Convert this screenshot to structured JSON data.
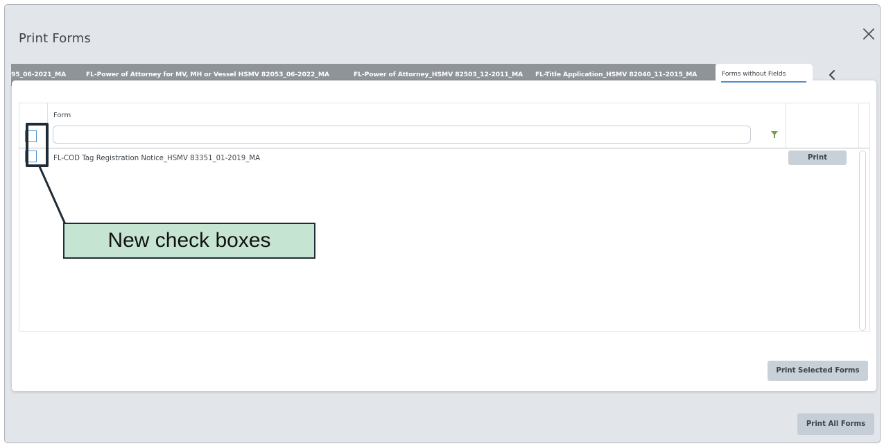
{
  "dialog": {
    "title": "Print Forms",
    "close_icon": "close-icon"
  },
  "tabs": [
    {
      "label": "95_06-2021_MA"
    },
    {
      "label": "FL-Power of Attorney for MV, MH or Vessel HSMV 82053_06-2022_MA"
    },
    {
      "label": "FL-Power of Attorney_HSMV 82503_12-2011_MA"
    },
    {
      "label": "FL-Title Application_HSMV 82040_11-2015_MA"
    }
  ],
  "active_tab": {
    "label": "Forms without Fields"
  },
  "tab_scroll_icon": "chevron-left-icon",
  "grid": {
    "column_header": "Form",
    "filter_value": "",
    "filter_icon": "filter-icon",
    "rows": [
      {
        "form": "FL-COD Tag Registration Notice_HSMV 83351_01-2019_MA",
        "print_label": "Print"
      }
    ]
  },
  "buttons": {
    "print_selected": "Print Selected Forms",
    "print_all": "Print All Forms"
  },
  "annotation": {
    "text": "New check boxes"
  },
  "colors": {
    "accent": "#4a8fd0",
    "tab_strip": "#8f9499",
    "annotation_fill": "#c6e4d2",
    "filter_icon": "#7a9a4e"
  }
}
